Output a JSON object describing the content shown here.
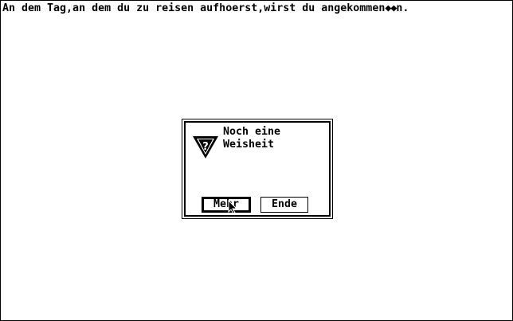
{
  "message": {
    "text_before": "An dem Tag,an dem du zu reisen aufhoerst,wirst du angekommen",
    "garbled_chars": "◆◆",
    "text_after": "n."
  },
  "dialog": {
    "icon": "question-mark-triangle-icon",
    "title_line_1": "Noch eine",
    "title_line_2": "Weisheit",
    "buttons": {
      "mehr_label": "Mehr",
      "ende_label": "Ende",
      "default": "Mehr"
    }
  },
  "colors": {
    "foreground": "#000000",
    "background": "#ffffff"
  },
  "cursor": "arrow-pointer-icon"
}
